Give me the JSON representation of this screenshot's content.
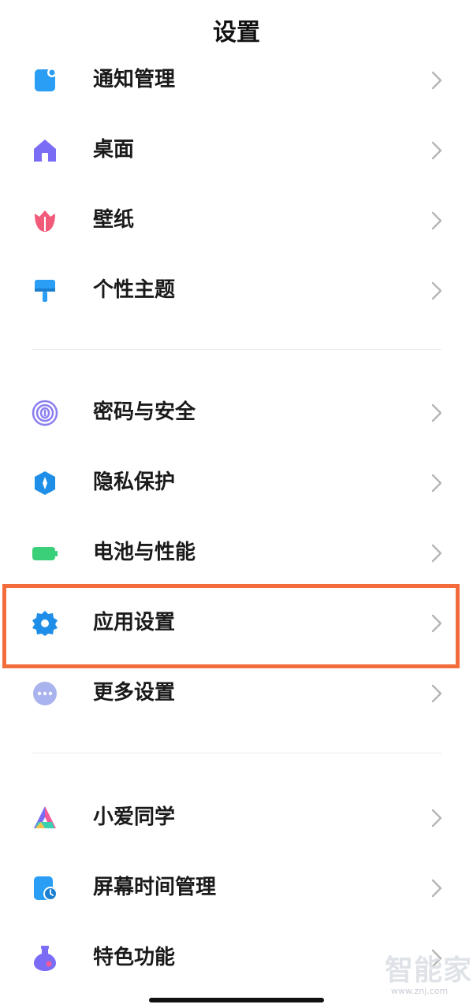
{
  "header": {
    "title": "设置"
  },
  "groups": {
    "personalization": [
      {
        "label": "通知管理",
        "icon": "notification-icon"
      },
      {
        "label": "桌面",
        "icon": "home-icon"
      },
      {
        "label": "壁纸",
        "icon": "tulip-icon"
      },
      {
        "label": "个性主题",
        "icon": "paintbrush-icon"
      }
    ],
    "system": [
      {
        "label": "密码与安全",
        "icon": "fingerprint-icon"
      },
      {
        "label": "隐私保护",
        "icon": "privacy-shield-icon"
      },
      {
        "label": "电池与性能",
        "icon": "battery-icon"
      },
      {
        "label": "应用设置",
        "icon": "gear-icon"
      },
      {
        "label": "更多设置",
        "icon": "more-dots-icon"
      }
    ],
    "services": [
      {
        "label": "小爱同学",
        "icon": "xiaoai-icon"
      },
      {
        "label": "屏幕时间管理",
        "icon": "screen-time-icon"
      },
      {
        "label": "特色功能",
        "icon": "flask-icon"
      }
    ]
  },
  "colors": {
    "highlight": "#f36c3c",
    "notification": "#2a9df4",
    "home": "#7b6cf6",
    "tulip": "#f25a7a",
    "paintbrush": "#2a9df4",
    "fingerprint": "#8b7ff0",
    "privacy": "#1e8ee8",
    "battery": "#3ad07a",
    "gear": "#1e8ee8",
    "more": "#a9b4ee",
    "screen_time": "#2a9df4",
    "flask": "#7b6cf6"
  },
  "watermark": {
    "text": "智能家",
    "url": "www.znj.com"
  }
}
